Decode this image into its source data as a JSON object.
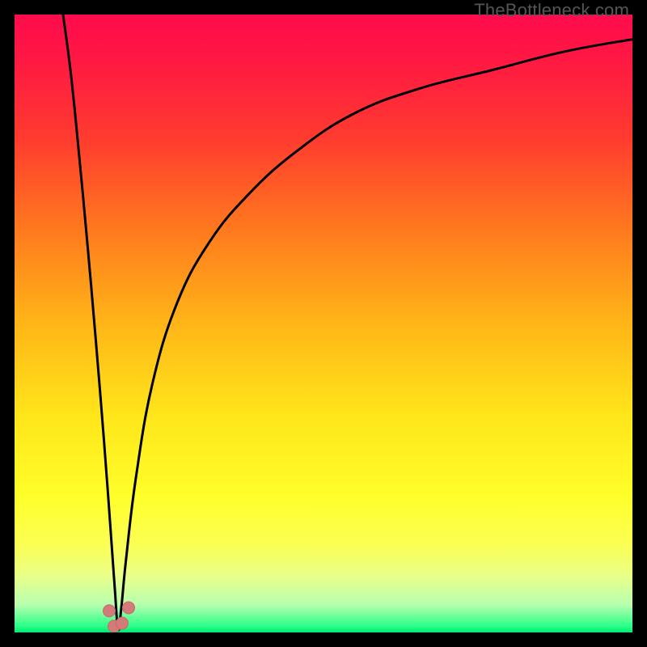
{
  "watermark": "TheBottleneck.com",
  "colors": {
    "frame": "#000000",
    "curve": "#000000",
    "marker_fill": "#d47a7a",
    "marker_stroke": "#c96868",
    "gradient_stops": [
      {
        "offset": 0.0,
        "color": "#ff0b4d"
      },
      {
        "offset": 0.08,
        "color": "#ff1a42"
      },
      {
        "offset": 0.2,
        "color": "#ff3b2f"
      },
      {
        "offset": 0.35,
        "color": "#ff7a1e"
      },
      {
        "offset": 0.5,
        "color": "#ffb518"
      },
      {
        "offset": 0.65,
        "color": "#ffe61a"
      },
      {
        "offset": 0.78,
        "color": "#ffff2a"
      },
      {
        "offset": 0.86,
        "color": "#faff55"
      },
      {
        "offset": 0.91,
        "color": "#e8ff8a"
      },
      {
        "offset": 0.955,
        "color": "#b8ffb0"
      },
      {
        "offset": 0.99,
        "color": "#2aff88"
      },
      {
        "offset": 1.0,
        "color": "#00e874"
      }
    ]
  },
  "chart_data": {
    "type": "line",
    "title": "",
    "xlabel": "",
    "ylabel": "",
    "x_range": [
      0,
      764
    ],
    "y_range_percent": [
      0,
      100
    ],
    "trough_x": 128,
    "series": [
      {
        "name": "bottleneck-curve",
        "note": "y as percent of plot height from bottom; V-shaped curve with minimum near x≈128",
        "x": [
          60,
          70,
          80,
          90,
          100,
          110,
          118,
          124,
          128,
          132,
          138,
          150,
          170,
          200,
          240,
          290,
          350,
          420,
          500,
          590,
          680,
          764
        ],
        "y_percent": [
          100,
          90,
          77,
          63,
          48,
          32,
          18,
          7,
          0.5,
          4,
          12,
          25,
          40,
          53,
          63,
          71,
          78,
          84,
          88,
          91,
          94,
          96
        ]
      }
    ],
    "markers": [
      {
        "x": 117,
        "y_percent": 3.5
      },
      {
        "x": 123,
        "y_percent": 1.0
      },
      {
        "x": 133,
        "y_percent": 1.5
      },
      {
        "x": 141,
        "y_percent": 4.0
      }
    ]
  }
}
